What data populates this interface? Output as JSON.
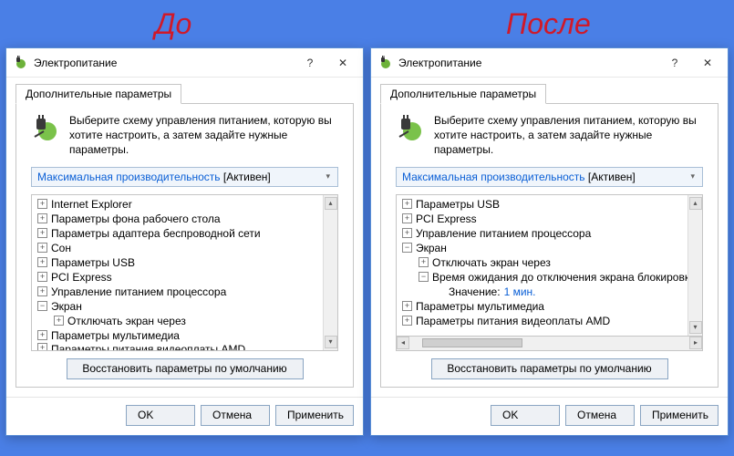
{
  "labels": {
    "before": "До",
    "after": "После"
  },
  "titlebar": {
    "title": "Электропитание",
    "help": "?",
    "close": "✕"
  },
  "tab": "Дополнительные параметры",
  "intro": "Выберите схему управления питанием, которую вы хотите настроить, а затем задайте нужные параметры.",
  "plan": {
    "name": "Максимальная производительность",
    "status": "[Активен]"
  },
  "buttons": {
    "restore": "Восстановить параметры по умолчанию",
    "ok": "OK",
    "cancel": "Отмена",
    "apply": "Применить"
  },
  "left_tree": [
    {
      "exp": "+",
      "ind": 0,
      "label": "Internet Explorer"
    },
    {
      "exp": "+",
      "ind": 0,
      "label": "Параметры фона рабочего стола"
    },
    {
      "exp": "+",
      "ind": 0,
      "label": "Параметры адаптера беспроводной сети"
    },
    {
      "exp": "+",
      "ind": 0,
      "label": "Сон"
    },
    {
      "exp": "+",
      "ind": 0,
      "label": "Параметры USB"
    },
    {
      "exp": "+",
      "ind": 0,
      "label": "PCI Express"
    },
    {
      "exp": "+",
      "ind": 0,
      "label": "Управление питанием процессора"
    },
    {
      "exp": "−",
      "ind": 0,
      "label": "Экран"
    },
    {
      "exp": "+",
      "ind": 1,
      "label": "Отключать экран через"
    },
    {
      "exp": "+",
      "ind": 0,
      "label": "Параметры мультимедиа"
    },
    {
      "exp": "+",
      "ind": 0,
      "label": "Параметры питания видеоплаты AMD",
      "cut": true
    }
  ],
  "right_tree": [
    {
      "exp": "+",
      "ind": 0,
      "label": "Параметры USB"
    },
    {
      "exp": "+",
      "ind": 0,
      "label": "PCI Express"
    },
    {
      "exp": "+",
      "ind": 0,
      "label": "Управление питанием процессора"
    },
    {
      "exp": "−",
      "ind": 0,
      "label": "Экран"
    },
    {
      "exp": "+",
      "ind": 1,
      "label": "Отключать экран через"
    },
    {
      "exp": "−",
      "ind": 1,
      "label": "Время ожидания до отключения экрана блокировки"
    },
    {
      "exp": "",
      "ind": 2,
      "label": "Значение:",
      "value": "1 мин."
    },
    {
      "exp": "+",
      "ind": 0,
      "label": "Параметры мультимедиа"
    },
    {
      "exp": "+",
      "ind": 0,
      "label": "Параметры питания видеоплаты AMD"
    }
  ]
}
